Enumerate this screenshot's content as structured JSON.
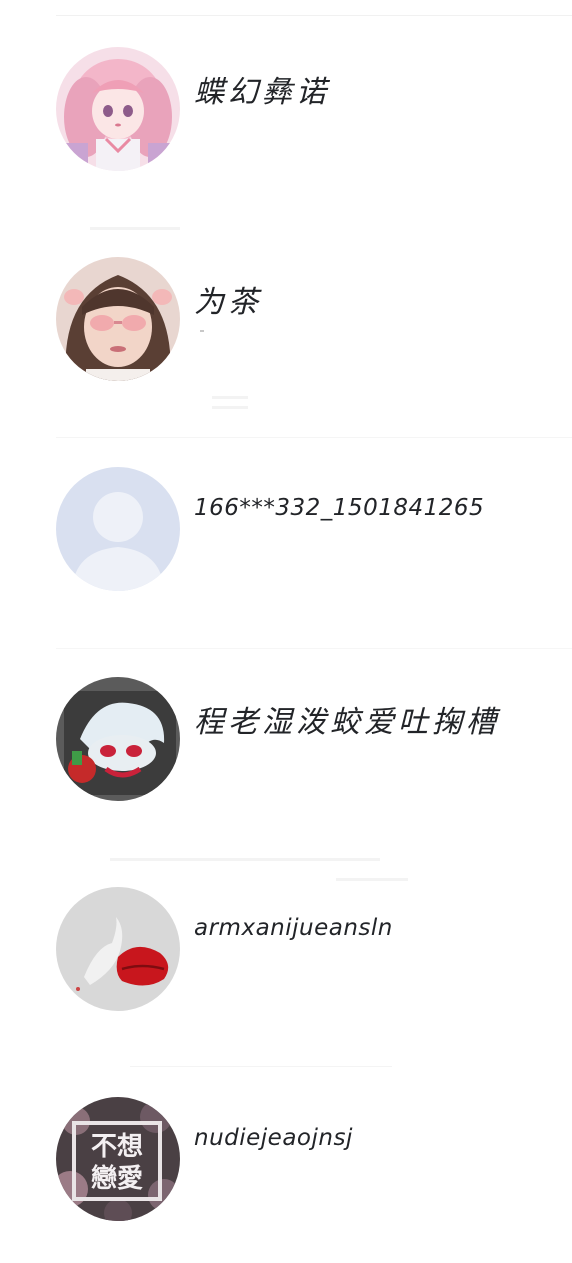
{
  "contacts": [
    {
      "name": "蝶幻彝诺",
      "avatar_icon": "anime-girl-avatar-icon"
    },
    {
      "name": "为茶",
      "avatar_icon": "girl-photo-avatar-icon"
    },
    {
      "name": "166***332_1501841265",
      "avatar_icon": "default-user-avatar-icon"
    },
    {
      "name": "程老湿泼蛟爱吐掬槽",
      "avatar_icon": "cartoon-character-avatar-icon"
    },
    {
      "name": "armxanijueansln",
      "avatar_icon": "lips-avatar-icon"
    },
    {
      "name": "nudiejeaojnsj",
      "avatar_icon": "text-art-avatar-icon"
    }
  ],
  "avatar_texts": {
    "text_art_line1": "不想",
    "text_art_line2": "戀愛"
  },
  "colors": {
    "name_text": "#222428",
    "default_avatar_bg": "#d9e0f0",
    "default_avatar_fg": "#eef1f8",
    "lips_red": "#c8161d"
  }
}
